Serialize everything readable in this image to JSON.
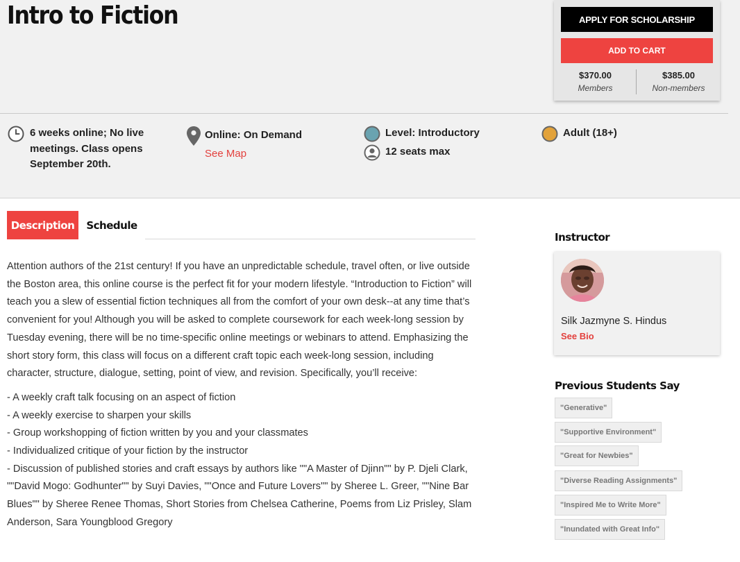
{
  "course": {
    "title": "Intro to Fiction"
  },
  "purchase": {
    "apply_label": "APPLY FOR SCHOLARSHIP",
    "cart_label": "ADD TO CART",
    "member_price": "$370.00",
    "member_label": "Members",
    "nonmember_price": "$385.00",
    "nonmember_label": "Non-members"
  },
  "details": {
    "schedule_line1": "6 weeks online; No live",
    "schedule_line2": "meetings. Class opens",
    "schedule_line3": "September 20th.",
    "location": "Online: On Demand",
    "see_map": "See Map",
    "level": "Level: Introductory",
    "seats": "12 seats max",
    "audience": "Adult (18+)",
    "icons": [
      "clock-icon",
      "map-pin-icon",
      "level-dot-icon",
      "person-icon",
      "audience-dot-icon"
    ]
  },
  "tabs": [
    {
      "label": "Description",
      "active": true
    },
    {
      "label": "Schedule",
      "active": false
    }
  ],
  "description": {
    "intro": "Attention authors of the 21st century! If you have an unpredictable schedule, travel often, or live outside the Boston area, this online course is the perfect fit for your modern lifestyle. “Introduction to Fiction” will teach you a slew of essential fiction techniques all from the comfort of your own desk--at any time that’s convenient for you! Although you will be asked to complete coursework for each week-long session by Tuesday evening, there will be no time-specific online meetings or webinars to attend. Emphasizing the short story form, this class will focus on a different craft topic each week-long session, including character, structure, dialogue, setting, point of view, and revision. Specifically, you’ll receive:",
    "items": [
      "- A weekly craft talk focusing on an aspect of fiction",
      "- A weekly exercise to sharpen your skills",
      "- Group workshopping of fiction written by you and your classmates",
      "- Individualized critique of your fiction by the instructor",
      "- Discussion of published stories and craft essays by authors like \"\"A Master of Djinn\"\" by P. Djeli Clark, \"\"David Mogo: Godhunter\"\" by Suyi Davies, \"\"Once and Future Lovers\"\" by Sheree L. Greer, \"\"Nine Bar Blues\"\" by Sheree Renee Thomas, Short Stories from Chelsea Catherine, Poems from Liz Prisley, Slam Anderson, Sara Youngblood Gregory"
    ]
  },
  "sidebar": {
    "instructor_heading": "Instructor",
    "instructor_name": "Silk Jazmyne S. Hindus",
    "see_bio": "See Bio",
    "reviews_heading": "Previous Students Say",
    "tags": [
      "\"Generative\"",
      "\"Supportive Environment\"",
      "\"Great for Newbies\"",
      "\"Diverse Reading Assignments\"",
      "\"Inspired Me to Write More\"",
      "\"Inundated with Great Info\""
    ]
  },
  "colors": {
    "accent": "#ee4340",
    "link": "#e3403d",
    "level_dot": "#6aa3b0",
    "audience_dot": "#e2a23a"
  }
}
